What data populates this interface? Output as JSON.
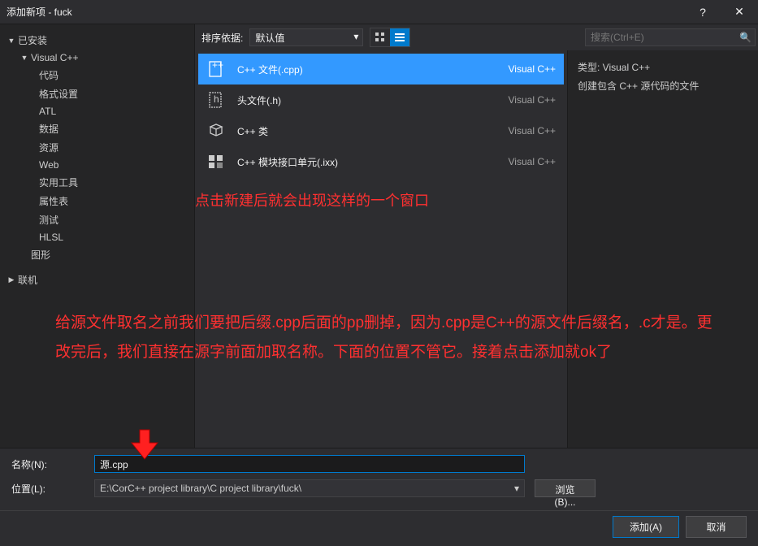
{
  "window": {
    "title": "添加新项 - fuck"
  },
  "sidebar": {
    "installed": "已安装",
    "vcpp": "Visual C++",
    "items": [
      "代码",
      "格式设置",
      "ATL",
      "数据",
      "资源",
      "Web",
      "实用工具",
      "属性表",
      "测试",
      "HLSL"
    ],
    "graphics": "图形",
    "online": "联机"
  },
  "toolbar": {
    "sort_label": "排序依据:",
    "sort_value": "默认值",
    "search_placeholder": "搜索(Ctrl+E)"
  },
  "templates": [
    {
      "name": "C++ 文件(.cpp)",
      "lang": "Visual C++",
      "icon": "cpp"
    },
    {
      "name": "头文件(.h)",
      "lang": "Visual C++",
      "icon": "h"
    },
    {
      "name": "C++ 类",
      "lang": "Visual C++",
      "icon": "class"
    },
    {
      "name": "C++ 模块接口单元(.ixx)",
      "lang": "Visual C++",
      "icon": "module"
    }
  ],
  "details": {
    "type_label": "类型:  Visual C++",
    "desc": "创建包含 C++ 源代码的文件"
  },
  "annotations": {
    "line1": "点击新建后就会出现这样的一个窗口",
    "line2": "给源文件取名之前我们要把后缀.cpp后面的pp删掉，因为.cpp是C++的源文件后缀名，.c才是。更改完后，我们直接在源字前面加取名称。下面的位置不管它。接着点击添加就ok了"
  },
  "form": {
    "name_label": "名称(N):",
    "name_value": "源.cpp",
    "location_label": "位置(L):",
    "location_value": "E:\\CorC++ project library\\C project library\\fuck\\",
    "browse": "浏览(B)..."
  },
  "buttons": {
    "add": "添加(A)",
    "cancel": "取消"
  }
}
